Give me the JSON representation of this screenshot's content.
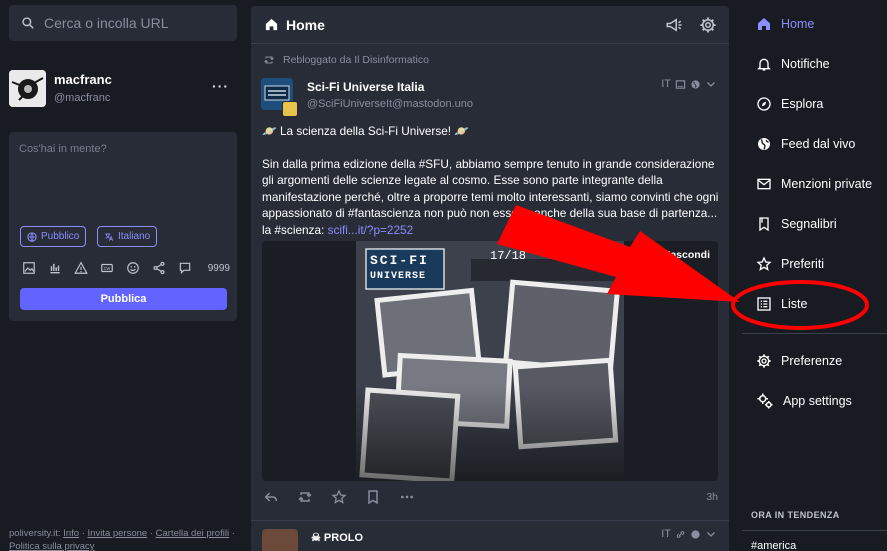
{
  "search": {
    "placeholder": "Cerca o incolla URL"
  },
  "account": {
    "name": "macfranc",
    "handle": "@macfranc",
    "more": "···"
  },
  "compose": {
    "placeholder": "Cos'hai in mente?",
    "visibility": "Pubblico",
    "language": "Italiano",
    "counter": "9999",
    "publish": "Pubblica"
  },
  "footer": {
    "site": "poliversity.it",
    "info": "Info",
    "invite": "Invita persone",
    "profile_dir": "Cartella dei profili",
    "privacy": "Politica sulla privacy"
  },
  "column": {
    "title": "Home"
  },
  "post": {
    "reblog_label": "Rebloggato da Il Disinformatico",
    "author": "Sci-Fi Universe Italia",
    "handle": "@SciFiUniverseIt@mastodon.uno",
    "lang": "IT",
    "headline": "🪐 La scienza della Sci-Fi Universe! 🪐",
    "text": "Sin dalla prima edizione della #SFU, abbiamo sempre tenuto in grande considerazione gli argomenti delle scienze legate al cosmo. Esse sono parte integrante della manifestazione perché, oltre a proporre temi molto interessanti, siamo convinti che ogni appassionato di #fantascienza non può non esserlo anche della sua base di partenza... la #scienza: ",
    "link": "scifi...it/?p=2252",
    "media_hide": "Nascondi",
    "media_logo_1": "SCI-FI",
    "media_logo_2": "UNIVERSE",
    "media_date": "17/18",
    "time": "3h"
  },
  "post2": {
    "author": "☠ PROLO",
    "lang": "IT"
  },
  "nav": {
    "items": [
      {
        "label": "Home",
        "icon": "home-icon"
      },
      {
        "label": "Notifiche",
        "icon": "bell-icon"
      },
      {
        "label": "Esplora",
        "icon": "compass-icon"
      },
      {
        "label": "Feed dal vivo",
        "icon": "globe-icon"
      },
      {
        "label": "Menzioni private",
        "icon": "mail-icon"
      },
      {
        "label": "Segnalibri",
        "icon": "bookmark-icon"
      },
      {
        "label": "Preferiti",
        "icon": "star-icon"
      },
      {
        "label": "Liste",
        "icon": "list-icon"
      },
      {
        "label": "Preferenze",
        "icon": "gear-icon"
      },
      {
        "label": "App settings",
        "icon": "gears-icon"
      }
    ]
  },
  "trending": {
    "header": "ORA IN TENDENZA",
    "tag": "#america"
  },
  "colors": {
    "accent": "#8c8dff",
    "publish": "#6364ff",
    "annotation": "#ff0000"
  }
}
